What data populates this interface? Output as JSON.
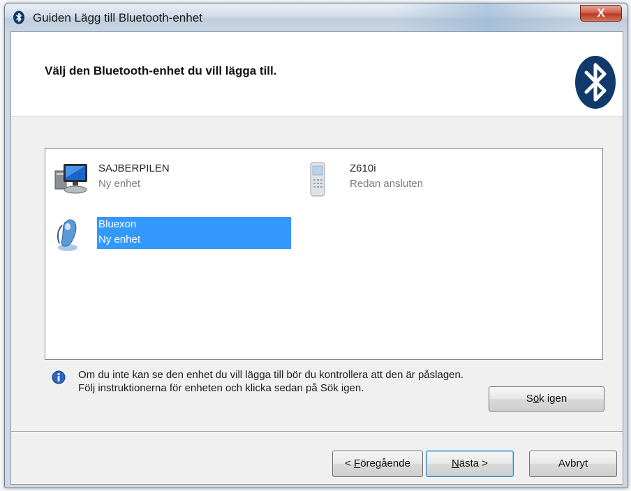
{
  "window": {
    "title": "Guiden Lägg till Bluetooth-enhet",
    "close_label": "X"
  },
  "header": {
    "title": "Välj den Bluetooth-enhet du vill lägga till."
  },
  "devices": [
    {
      "name": "SAJBERPILEN",
      "status": "Ny enhet",
      "icon": "computer-icon",
      "selected": false
    },
    {
      "name": "Z610i",
      "status": "Redan ansluten",
      "icon": "phone-icon",
      "selected": false
    },
    {
      "name": "Bluexon",
      "status": "Ny enhet",
      "icon": "bluetooth-headset-icon",
      "selected": true
    }
  ],
  "info": {
    "text": "Om du inte kan se den enhet du vill lägga till bör du kontrollera att den är påslagen. Följ instruktionerna för enheten och klicka sedan på Sök igen.",
    "icon": "info-icon"
  },
  "buttons": {
    "search_again": {
      "pre": "S",
      "key": "ö",
      "post": "k igen"
    },
    "back": {
      "pre": "< ",
      "key": "F",
      "post": "öregående"
    },
    "next": {
      "pre": "",
      "key": "N",
      "post": "ästa >"
    },
    "cancel": {
      "label": "Avbryt"
    }
  },
  "colors": {
    "selection": "#3399ff",
    "close_button": "#c9462e",
    "bluetooth_logo": "#0f3a6b"
  }
}
